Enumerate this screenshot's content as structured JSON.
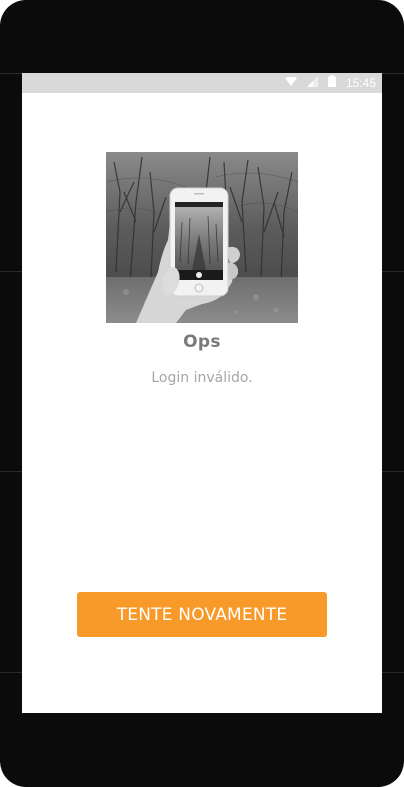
{
  "status_bar": {
    "time": "15:45",
    "icons": [
      "wifi-icon",
      "signal-icon",
      "battery-icon"
    ]
  },
  "illustration": {
    "icon": "hand-holding-phone-photo"
  },
  "error": {
    "title": "Ops",
    "message": "Login inválido."
  },
  "actions": {
    "retry_label": "TENTE NOVAMENTE"
  },
  "colors": {
    "accent": "#f79a2a",
    "status_bar": "#d9d9d9",
    "title_text": "#7a7a7a",
    "message_text": "#a6a6a6",
    "device_frame": "#0b0b0b"
  }
}
